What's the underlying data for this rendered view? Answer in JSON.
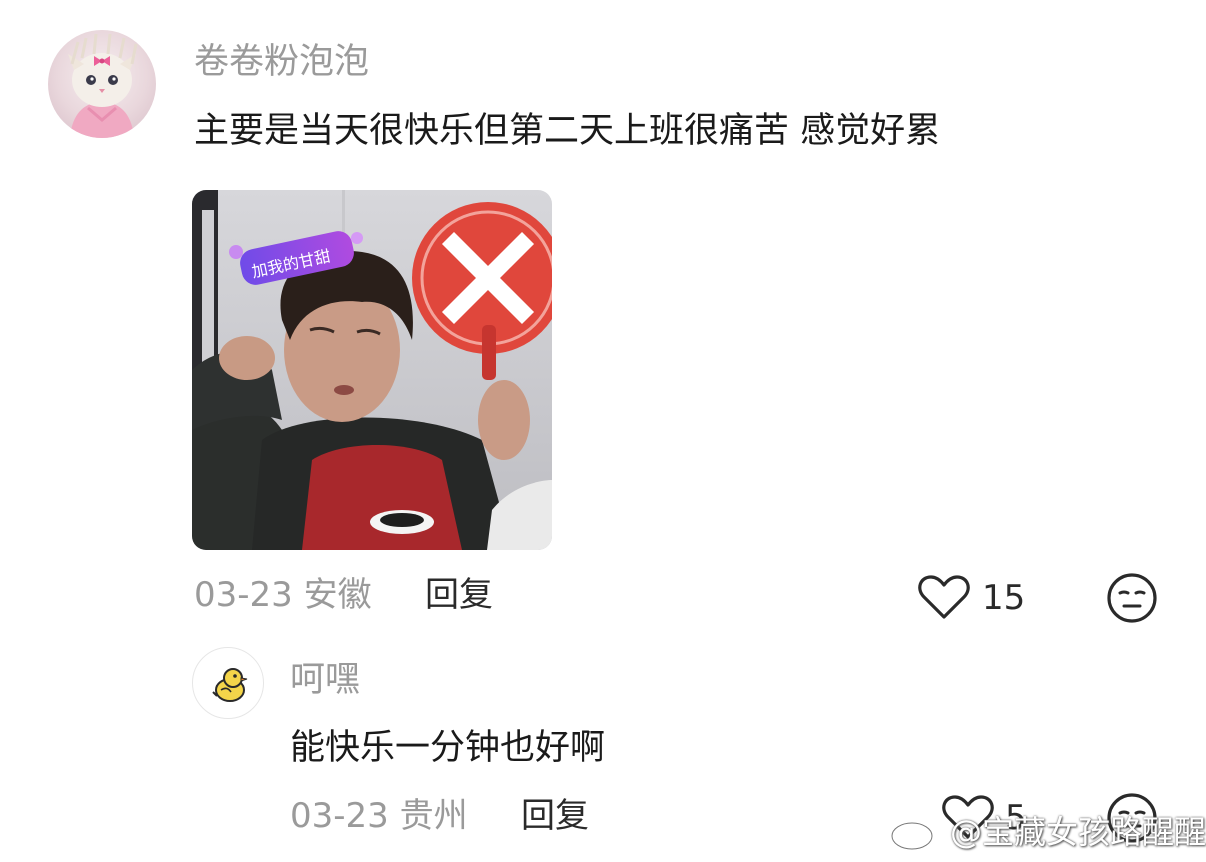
{
  "comment": {
    "username": "卷卷粉泡泡",
    "text": "主要是当天很快乐但第二天上班很痛苦 感觉好累",
    "date_location": "03-23 安徽",
    "reply_label": "回复",
    "like_count": "15",
    "image_sticker_text": "加我的甘甜",
    "icons": [
      "heart-outline-icon",
      "meh-face-icon"
    ]
  },
  "reply": {
    "username": "呵嘿",
    "text": "能快乐一分钟也好啊",
    "date_location": "03-23 贵州",
    "reply_label": "回复",
    "like_count": "5",
    "icons": [
      "heart-outline-icon",
      "meh-face-icon"
    ]
  },
  "watermark": {
    "text": "@宝藏女孩路醒醒"
  },
  "colors": {
    "username": "#9a9a9a",
    "text": "#1a1a1a",
    "icon": "#2a2a2a",
    "sign_red": "#e0473c"
  }
}
